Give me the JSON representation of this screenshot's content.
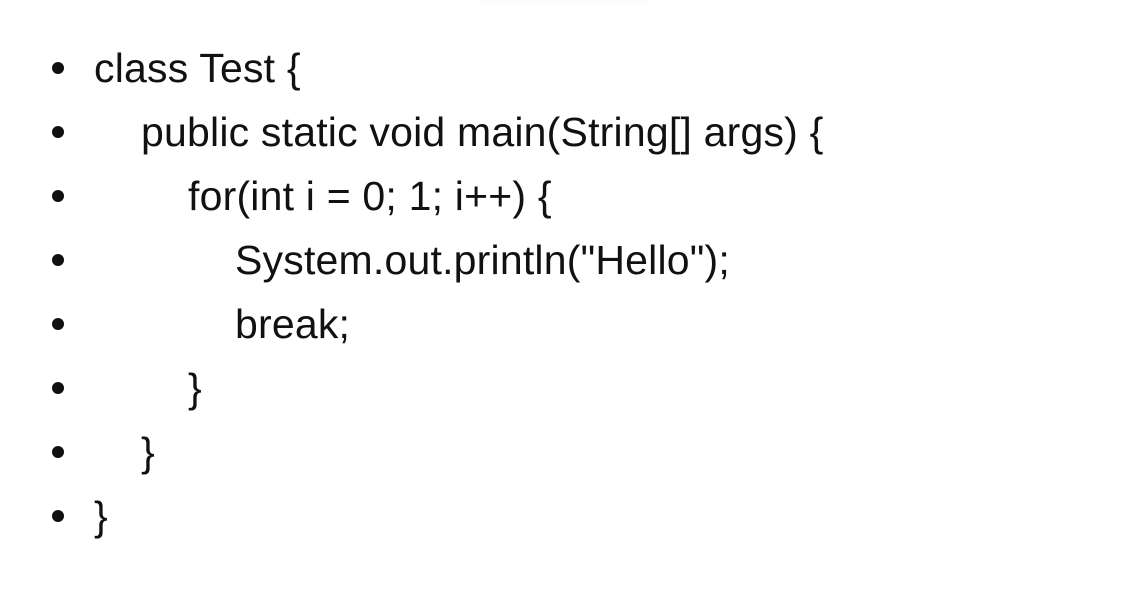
{
  "code_lines": [
    "class Test {",
    "public static void main(String[] args) {",
    "for(int i = 0; 1; i++) {",
    "System.out.println(\"Hello\");",
    "break;",
    "}",
    "}",
    "}"
  ],
  "bullet_symbol": "•"
}
